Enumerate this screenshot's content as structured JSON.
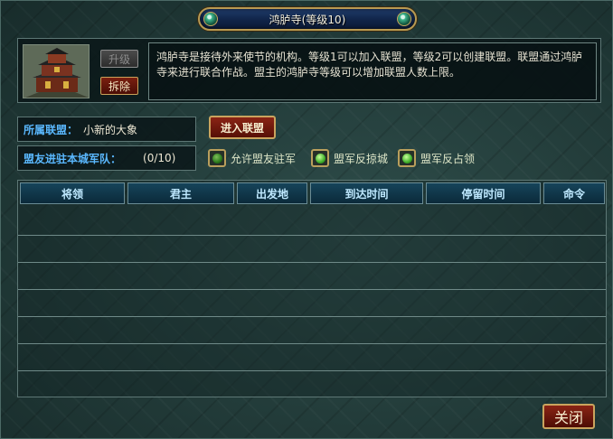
{
  "window": {
    "title": "鸿胪寺(等级10)"
  },
  "building": {
    "upgrade_label": "升级",
    "demolish_label": "拆除",
    "description": "鸿胪寺是接待外来使节的机构。等级1可以加入联盟，等级2可以创建联盟。联盟通过鸿胪寺来进行联合作战。盟主的鸿胪寺等级可以增加联盟人数上限。"
  },
  "alliance": {
    "label": "所属联盟：",
    "name": "小新的大象",
    "join_label": "进入联盟"
  },
  "troops": {
    "label": "盟友进驻本城军队：",
    "count": "(0/10)"
  },
  "options": [
    {
      "label": "允许盟友驻军",
      "checked": false
    },
    {
      "label": "盟军反掠城",
      "checked": true
    },
    {
      "label": "盟军反占领",
      "checked": true
    }
  ],
  "table": {
    "columns": [
      "将领",
      "君主",
      "出发地",
      "到达时间",
      "停留时间",
      "命令"
    ],
    "rows": []
  },
  "footer": {
    "close_label": "关闭"
  },
  "colors": {
    "label_blue": "#5ab8ff",
    "header_text": "#bfe9ff",
    "button_red": "#8a2415",
    "gold_border": "#c9a45e"
  }
}
